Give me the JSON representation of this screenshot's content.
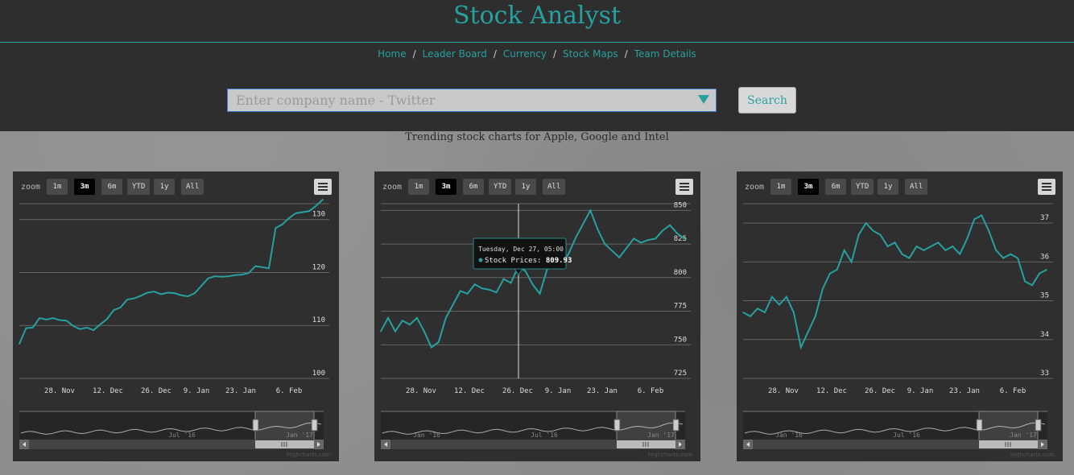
{
  "header": {
    "title": "Stock Analyst"
  },
  "nav": [
    {
      "label": "Home"
    },
    {
      "label": "Leader Board"
    },
    {
      "label": "Currency"
    },
    {
      "label": "Stock Maps"
    },
    {
      "label": "Team Details"
    }
  ],
  "search": {
    "placeholder": "Enter company name - Twitter",
    "button_label": "Search"
  },
  "subtitle": "Trending stock charts for Apple, Google and Intel",
  "colors": {
    "accent": "#27a0a0",
    "header_bg": "#2e2e2e",
    "panel_bg": "#2f2f2f"
  },
  "zoom": {
    "label": "zoom",
    "buttons": [
      "1m",
      "3m",
      "6m",
      "YTD",
      "1y",
      "All"
    ],
    "active": "3m"
  },
  "credit": "Highcharts.com",
  "chart_data": [
    {
      "type": "line",
      "x": [
        "28. Nov",
        "12. Dec",
        "26. Dec",
        "9. Jan",
        "23. Jan",
        "6. Feb"
      ],
      "y_ticks": [
        100,
        110,
        120,
        130
      ],
      "ylim": [
        100,
        133
      ],
      "values": [
        106.5,
        109.5,
        109.6,
        111.4,
        111.1,
        111.4,
        111.0,
        110.9,
        109.9,
        109.3,
        109.6,
        109.1,
        110.2,
        111.2,
        112.9,
        113.4,
        114.9,
        115.1,
        115.6,
        116.2,
        116.4,
        115.9,
        116.2,
        116.1,
        115.7,
        115.5,
        116.1,
        117.5,
        118.9,
        119.3,
        119.2,
        119.3,
        119.5,
        119.6,
        119.9,
        121.2,
        121.0,
        120.8,
        128.4,
        129.1,
        130.3,
        131.2,
        131.4,
        131.6,
        132.6,
        133.8
      ],
      "navigator_labels": [
        "Jul '16",
        "Jan '17"
      ]
    },
    {
      "type": "line",
      "x": [
        "28. Nov",
        "12. Dec",
        "26. Dec",
        "9. Jan",
        "23. Jan",
        "6. Feb"
      ],
      "y_ticks": [
        725,
        750,
        775,
        800,
        825,
        850
      ],
      "ylim": [
        725,
        855
      ],
      "values": [
        760,
        770,
        760,
        768,
        765,
        770,
        760,
        748,
        752,
        770,
        780,
        790,
        788,
        795,
        792,
        791,
        789,
        799,
        796,
        808,
        805,
        795,
        788,
        806,
        815,
        809,
        818,
        830,
        840,
        850,
        836,
        825,
        820,
        815,
        822,
        829,
        826,
        828,
        829,
        835,
        839,
        833,
        829
      ],
      "tooltip": {
        "date": "Tuesday, Dec 27, 05:00",
        "series": "Stock Prices",
        "value": "809.93"
      },
      "navigator_labels": [
        "Jan '16",
        "Jul '16",
        "Jan '17"
      ]
    },
    {
      "type": "line",
      "x": [
        "28. Nov",
        "12. Dec",
        "26. Dec",
        "9. Jan",
        "23. Jan",
        "6. Feb"
      ],
      "y_ticks": [
        33,
        34,
        35,
        36,
        37
      ],
      "ylim": [
        33,
        37.5
      ],
      "values": [
        34.7,
        34.6,
        34.8,
        34.7,
        35.1,
        34.9,
        35.1,
        34.7,
        33.8,
        34.2,
        34.6,
        35.3,
        35.7,
        35.8,
        36.3,
        36.0,
        36.7,
        37.0,
        36.8,
        36.7,
        36.4,
        36.5,
        36.2,
        36.1,
        36.4,
        36.3,
        36.4,
        36.5,
        36.3,
        36.4,
        36.2,
        36.6,
        37.1,
        37.2,
        36.8,
        36.3,
        36.1,
        36.2,
        36.1,
        35.5,
        35.4,
        35.7,
        35.8
      ],
      "navigator_labels": [
        "Jan '16",
        "Jul '16",
        "Jan '17"
      ]
    }
  ]
}
